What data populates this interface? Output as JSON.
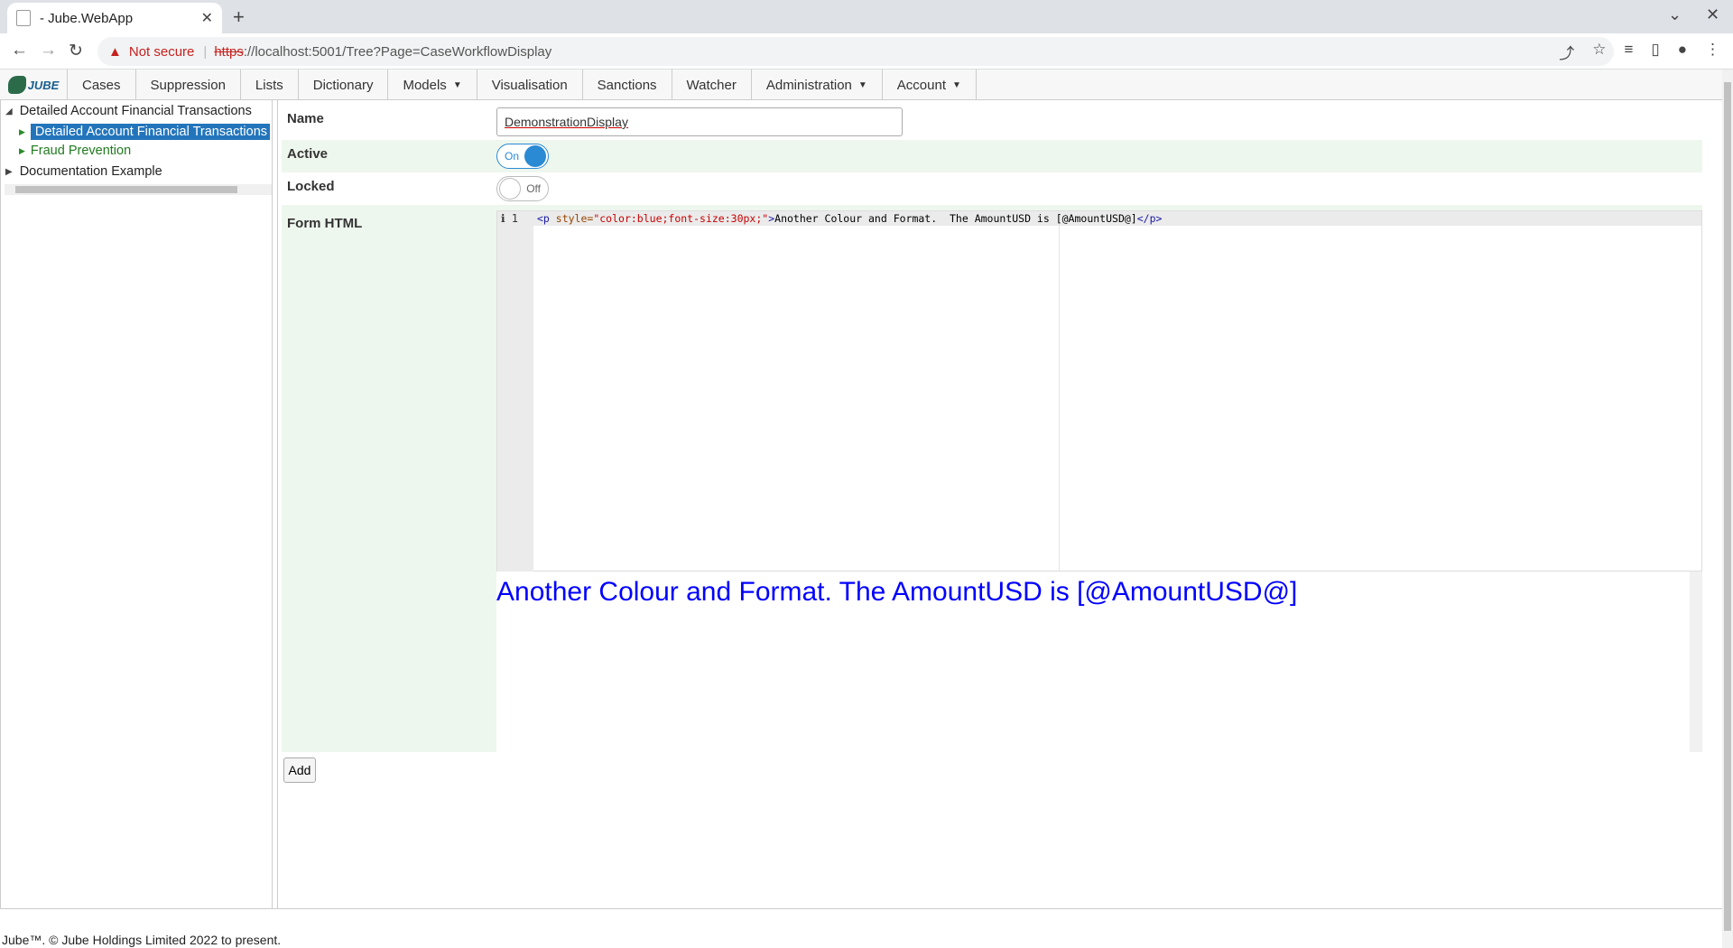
{
  "browser": {
    "tab_title": "- Jube.WebApp",
    "new_tab": "+",
    "not_secure": "Not secure",
    "url_scheme": "https",
    "url_rest": "://localhost:5001/Tree?Page=CaseWorkflowDisplay"
  },
  "menu": {
    "logo_text": "JUBE",
    "items": [
      {
        "label": "Cases"
      },
      {
        "label": "Suppression"
      },
      {
        "label": "Lists"
      },
      {
        "label": "Dictionary"
      },
      {
        "label": "Models",
        "dropdown": true
      },
      {
        "label": "Visualisation"
      },
      {
        "label": "Sanctions"
      },
      {
        "label": "Watcher"
      },
      {
        "label": "Administration",
        "dropdown": true
      },
      {
        "label": "Account",
        "dropdown": true
      }
    ]
  },
  "tree": {
    "root1": "Detailed Account Financial Transactions",
    "child_selected": "Detailed Account Financial Transactions Cases Workflow",
    "child2": "Fraud Prevention",
    "root2": "Documentation Example"
  },
  "form": {
    "name_label": "Name",
    "name_value": "DemonstrationDisplay",
    "active_label": "Active",
    "active_state": "On",
    "locked_label": "Locked",
    "locked_state": "Off",
    "html_label": "Form HTML",
    "line_number": "1",
    "code_open_tag": "<p",
    "code_attr": " style=",
    "code_value": "\"color:blue;font-size:30px;\"",
    "code_gt": ">",
    "code_text": "Another Colour and Format.  The AmountUSD is [@AmountUSD@]",
    "code_close_tag": "</p>",
    "preview_text": "Another Colour and Format. The AmountUSD is [@AmountUSD@]",
    "add_button": "Add"
  },
  "colors": {
    "toggle_on": "#2a8ad4",
    "selected_bg": "#2375bb",
    "row_highlight": "#eef7ee"
  },
  "footer": {
    "text": "Jube™. © Jube Holdings Limited 2022 to present."
  }
}
